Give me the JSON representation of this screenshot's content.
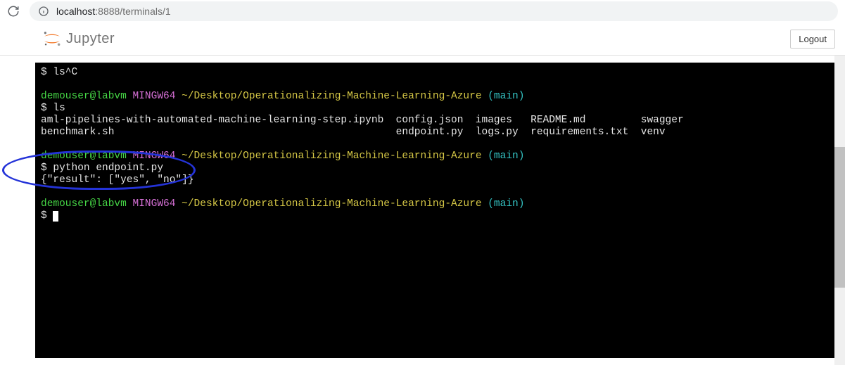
{
  "browser": {
    "url_host": "localhost",
    "url_port_path": ":8888/terminals/1"
  },
  "header": {
    "brand": "Jupyter",
    "logout_label": "Logout"
  },
  "terminal": {
    "lines": [
      {
        "segments": [
          {
            "cls": "c-white",
            "text": "$ ls^C"
          }
        ]
      },
      {
        "segments": []
      },
      {
        "segments": [
          {
            "cls": "c-green",
            "text": "demouser@labvm"
          },
          {
            "cls": "c-white",
            "text": " "
          },
          {
            "cls": "c-purple",
            "text": "MINGW64"
          },
          {
            "cls": "c-white",
            "text": " "
          },
          {
            "cls": "c-yellow",
            "text": "~/Desktop/Operationalizing-Machine-Learning-Azure"
          },
          {
            "cls": "c-white",
            "text": " "
          },
          {
            "cls": "c-cyan",
            "text": "(main)"
          }
        ]
      },
      {
        "segments": [
          {
            "cls": "c-white",
            "text": "$ ls"
          }
        ]
      },
      {
        "segments": [
          {
            "cls": "c-white",
            "text": "aml-pipelines-with-automated-machine-learning-step.ipynb  config.json  images   README.md         swagger"
          }
        ]
      },
      {
        "segments": [
          {
            "cls": "c-white",
            "text": "benchmark.sh                                              endpoint.py  logs.py  requirements.txt  venv"
          }
        ]
      },
      {
        "segments": []
      },
      {
        "segments": [
          {
            "cls": "c-green",
            "text": "demouser@labvm"
          },
          {
            "cls": "c-white",
            "text": " "
          },
          {
            "cls": "c-purple",
            "text": "MINGW64"
          },
          {
            "cls": "c-white",
            "text": " "
          },
          {
            "cls": "c-yellow",
            "text": "~/Desktop/Operationalizing-Machine-Learning-Azure"
          },
          {
            "cls": "c-white",
            "text": " "
          },
          {
            "cls": "c-cyan",
            "text": "(main)"
          }
        ]
      },
      {
        "segments": [
          {
            "cls": "c-white",
            "text": "$ python endpoint.py"
          }
        ]
      },
      {
        "segments": [
          {
            "cls": "c-white",
            "text": "{\"result\": [\"yes\", \"no\"]}"
          }
        ]
      },
      {
        "segments": []
      },
      {
        "segments": [
          {
            "cls": "c-green",
            "text": "demouser@labvm"
          },
          {
            "cls": "c-white",
            "text": " "
          },
          {
            "cls": "c-purple",
            "text": "MINGW64"
          },
          {
            "cls": "c-white",
            "text": " "
          },
          {
            "cls": "c-yellow",
            "text": "~/Desktop/Operationalizing-Machine-Learning-Azure"
          },
          {
            "cls": "c-white",
            "text": " "
          },
          {
            "cls": "c-cyan",
            "text": "(main)"
          }
        ]
      },
      {
        "segments": [
          {
            "cls": "c-white",
            "text": "$ "
          }
        ],
        "cursor": true
      }
    ]
  }
}
